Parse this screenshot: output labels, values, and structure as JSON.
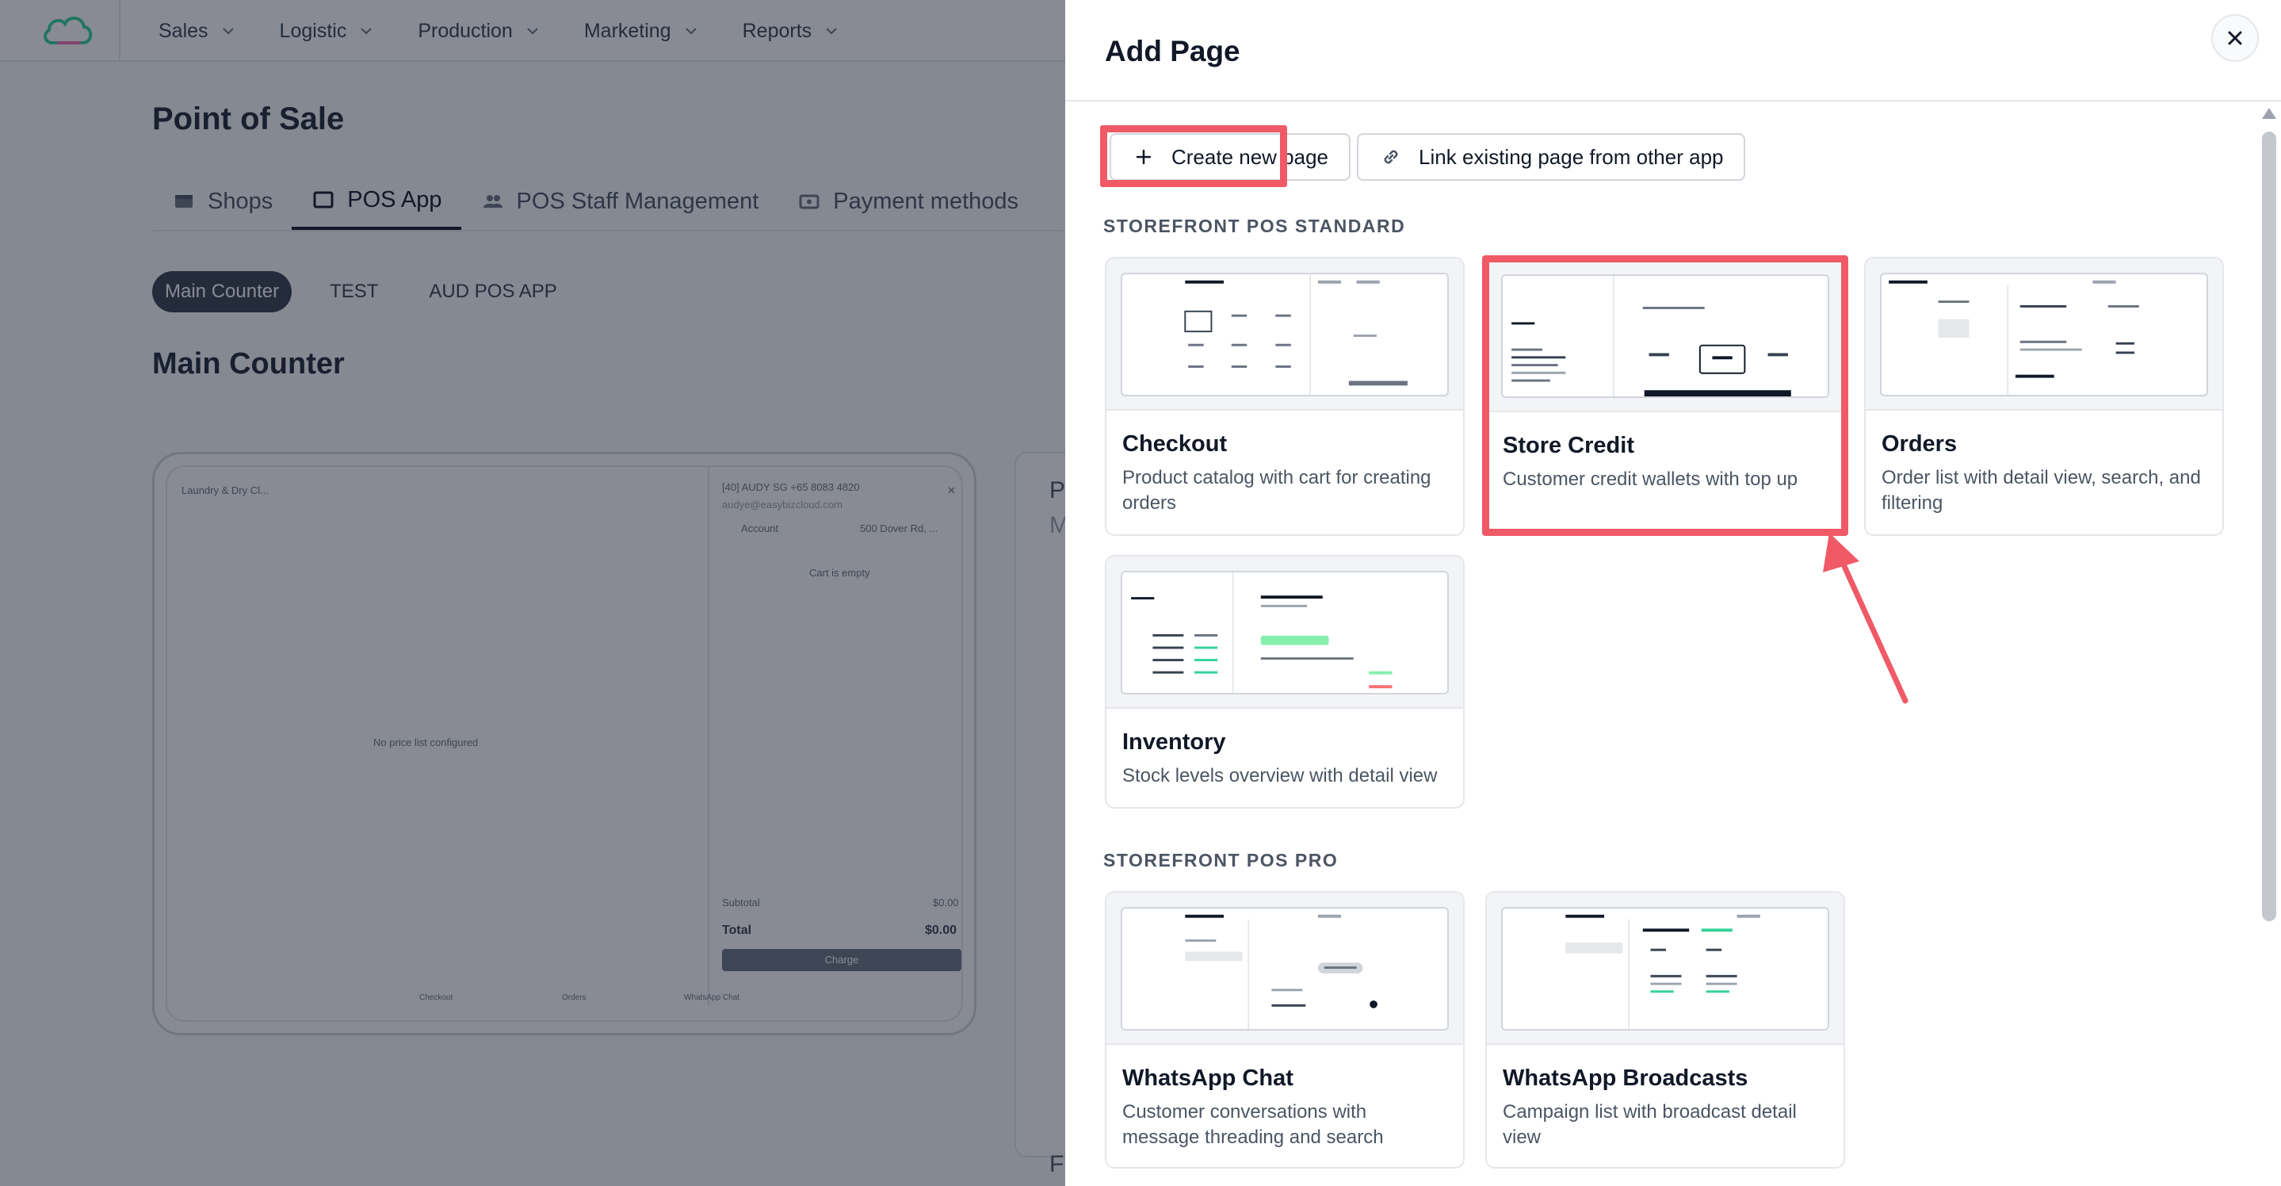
{
  "app": {
    "nav": [
      {
        "label": "Sales"
      },
      {
        "label": "Logistic"
      },
      {
        "label": "Production"
      },
      {
        "label": "Marketing"
      },
      {
        "label": "Reports"
      }
    ],
    "page_title": "Point of Sale",
    "tabs": [
      {
        "label": "Shops",
        "icon": "store-icon"
      },
      {
        "label": "POS App",
        "icon": "tablet-icon",
        "active": true
      },
      {
        "label": "POS Staff Management",
        "icon": "users-icon"
      },
      {
        "label": "Payment methods",
        "icon": "card-icon"
      }
    ],
    "counters": [
      {
        "label": "Main Counter",
        "active": true
      },
      {
        "label": "TEST"
      },
      {
        "label": "AUD POS APP"
      }
    ],
    "section_title": "Main Counter",
    "device": {
      "shop_name": "Laundry & Dry Cl...",
      "customer_line": "[40] AUDY SG +65 8083 4820",
      "customer_email": "audye@easybizcloud.com",
      "account_label": "Account",
      "address_label": "500 Dover Rd, ...",
      "cart_empty": "Cart is empty",
      "no_price_list": "No price list configured",
      "subtotal_label": "Subtotal",
      "subtotal_value": "$0.00",
      "total_label": "Total",
      "total_value": "$0.00",
      "charge_label": "Charge",
      "bottom_tabs": [
        "Checkout",
        "Orders",
        "WhatsApp Chat"
      ]
    },
    "right_card_letters": [
      "P",
      "M",
      "F"
    ]
  },
  "modal": {
    "title": "Add Page",
    "create_button": "Create new page",
    "link_button": "Link existing page from other app",
    "groups": [
      {
        "title": "STOREFRONT POS STANDARD",
        "cards": [
          {
            "title": "Checkout",
            "desc": "Product catalog with cart for creating orders"
          },
          {
            "title": "Store Credit",
            "desc": "Customer credit wallets with top up"
          },
          {
            "title": "Orders",
            "desc": "Order list with detail view, search, and filtering"
          },
          {
            "title": "Inventory",
            "desc": "Stock levels overview with detail view"
          }
        ]
      },
      {
        "title": "STOREFRONT POS PRO",
        "cards": [
          {
            "title": "WhatsApp Chat",
            "desc": "Customer conversations with message threading and search"
          },
          {
            "title": "WhatsApp Broadcasts",
            "desc": "Campaign list with broadcast detail view"
          }
        ]
      }
    ]
  },
  "colors": {
    "highlight": "#ef5a66",
    "overlay": "rgba(17,24,39,0.5)"
  }
}
